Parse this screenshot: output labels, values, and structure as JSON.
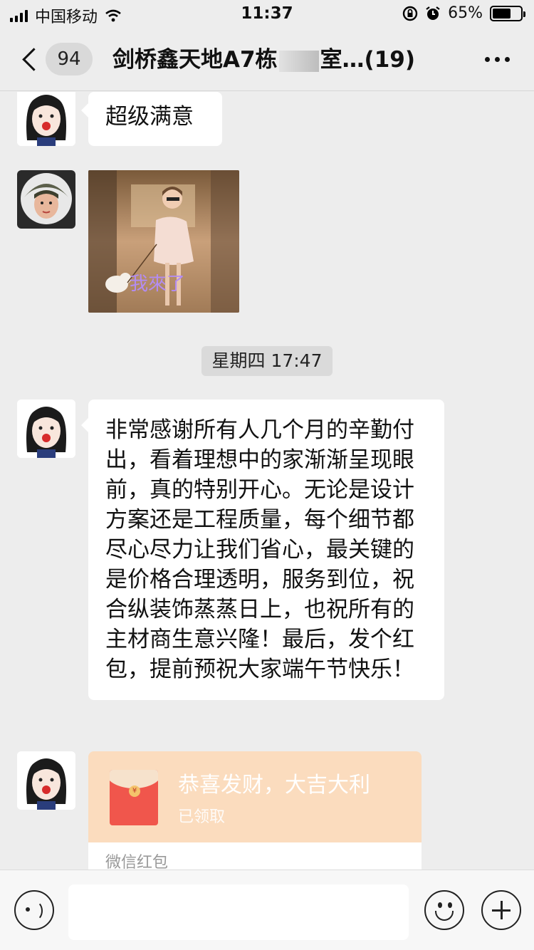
{
  "status_bar": {
    "carrier": "中国移动",
    "time": "11:37",
    "battery": "65%",
    "battery_level": 0.65
  },
  "nav": {
    "unread_count": "94",
    "title": "剑桥鑫天地A7栋",
    "title_suffix": "室…(19)"
  },
  "messages": {
    "msg1_text": "超级满意",
    "image_caption": "我來了",
    "timestamp": "星期四 17:47",
    "msg2_text": "非常感谢所有人几个月的辛勤付出，看着理想中的家渐渐呈现眼前，真的特别开心。无论是设计方案还是工程质量，每个细节都尽心尽力让我们省心，最关键的是价格合理透明，服务到位，祝合纵装饰蒸蒸日上，也祝所有的主材商生意兴隆！最后，发个红包，提前预祝大家端午节快乐！",
    "red_packet": {
      "title": "恭喜发财，大吉大利",
      "status": "已领取",
      "source": "微信红包",
      "coin_symbol": "¥"
    }
  },
  "input": {
    "placeholder": ""
  },
  "colors": {
    "background": "#ededed",
    "red_packet_bg": "#fbdcbe",
    "envelope": "#f0564c"
  }
}
